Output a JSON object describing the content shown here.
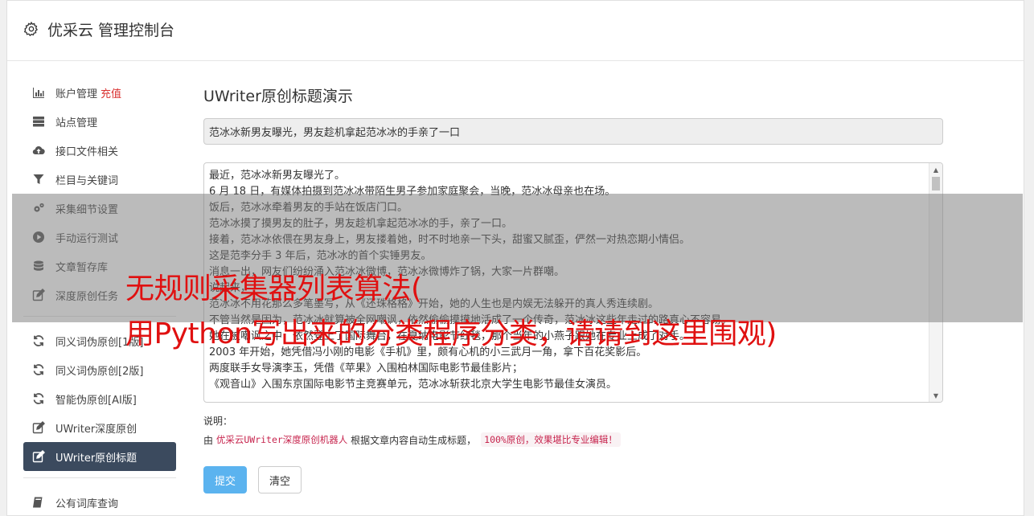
{
  "header": {
    "title": "优采云 管理控制台",
    "icon": "gear-icon"
  },
  "sidebar": {
    "items": [
      {
        "label": "账户管理",
        "tag": "充值",
        "icon": "bar-chart-icon"
      },
      {
        "label": "站点管理",
        "icon": "server-icon"
      },
      {
        "label": "接口文件相关",
        "icon": "cloud-upload-icon"
      },
      {
        "label": "栏目与关键词",
        "icon": "filter-icon"
      },
      {
        "label": "采集细节设置",
        "icon": "gears-icon"
      },
      {
        "label": "手动运行测试",
        "icon": "play-icon"
      },
      {
        "label": "文章暂存库",
        "icon": "database-icon"
      },
      {
        "label": "深度原创任务",
        "icon": "edit-icon"
      }
    ],
    "items2": [
      {
        "label": "同义词伪原创[1版]",
        "icon": "refresh-icon"
      },
      {
        "label": "同义词伪原创[2版]",
        "icon": "refresh-icon"
      },
      {
        "label": "智能伪原创[AI版]",
        "icon": "refresh-icon"
      },
      {
        "label": "UWriter深度原创",
        "icon": "edit-icon"
      },
      {
        "label": "UWriter原创标题",
        "icon": "edit-icon",
        "active": true
      }
    ],
    "items3": [
      {
        "label": "公有词库查询",
        "icon": "book-icon"
      }
    ]
  },
  "main": {
    "heading": "UWriter原创标题演示",
    "title_value": "范冰冰新男友曝光，男友趁机拿起范冰冰的手亲了一口",
    "content_lines": [
      "最近，范冰冰新男友曝光了。",
      "6 月 18 日，有媒体拍摄到范冰冰带陌生男子参加家庭聚会，当晚，范冰冰母亲也在场。",
      "饭后，范冰冰牵着男友的手站在饭店门口。",
      "范冰冰摸了摸男友的肚子，男友趁机拿起范冰冰的手，亲了一口。",
      "接着，范冰冰依偎在男友身上，男友搂着她，时不时地亲一下头，甜蜜又腻歪，俨然一对热恋期小情侣。",
      "这是范李分手 3 年后，范冰冰的首个实锤男友。",
      "消息一出，网友们纷纷涌入范冰冰微博，范冰冰微博炸了锅，大家一片群嘲。",
      "说起来，",
      "范冰冰不用花那么多笔墨写，从《还珠格格》开始，她的人生也是内娱无法躲开的真人秀连续剧。",
      "不管当然是因为，范冰冰就算被全网嘲讽，依然偷偷摸摸地活成了一个传奇，范冰冰这些年走过的路真心不容易。",
      "她在被嘲讽之中，依然登上了国际舞台，在戛纳电影节红毯，那个当年的小燕子跟她在专业上成了对手。",
      "2003 年开始，她凭借冯小刚的电影《手机》里，颇有心机的小三武月一角，拿下百花奖影后。",
      "两度联手女导演李玉，凭借《苹果》入围柏林国际电影节最佳影片；",
      "《观音山》入围东京国际电影节主竞赛单元，范冰冰斩获北京大学生电影节最佳女演员。"
    ],
    "note_label": "说明：",
    "note_prefix": "由",
    "note_code": "优采云UWriter深度原创机器人",
    "note_middle": "根据文章内容自动生成标题，",
    "note_pill": "100%原创，效果堪比专业编辑！",
    "submit_label": "提交",
    "clear_label": "清空"
  },
  "overlay": {
    "line1": "无规则采集器列表算法(",
    "line2": "用Python写出来的分类程序分类，请请到这里围观)"
  }
}
